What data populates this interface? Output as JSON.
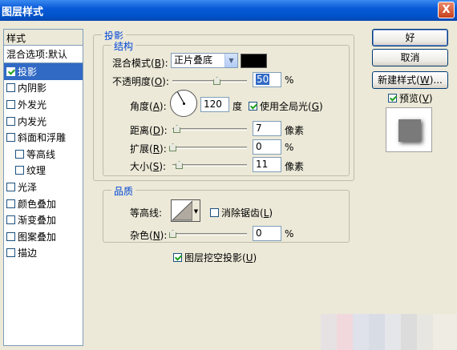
{
  "window": {
    "title": "图层样式",
    "close_glyph": "X"
  },
  "styles_panel": {
    "header": "样式",
    "blend_options": "混合选项:默认",
    "items": [
      {
        "label": "投影",
        "checked": true,
        "selected": true,
        "indent": false
      },
      {
        "label": "内阴影",
        "checked": false,
        "selected": false,
        "indent": false
      },
      {
        "label": "外发光",
        "checked": false,
        "selected": false,
        "indent": false
      },
      {
        "label": "内发光",
        "checked": false,
        "selected": false,
        "indent": false
      },
      {
        "label": "斜面和浮雕",
        "checked": false,
        "selected": false,
        "indent": false
      },
      {
        "label": "等高线",
        "checked": false,
        "selected": false,
        "indent": true
      },
      {
        "label": "纹理",
        "checked": false,
        "selected": false,
        "indent": true
      },
      {
        "label": "光泽",
        "checked": false,
        "selected": false,
        "indent": false
      },
      {
        "label": "颜色叠加",
        "checked": false,
        "selected": false,
        "indent": false
      },
      {
        "label": "渐变叠加",
        "checked": false,
        "selected": false,
        "indent": false
      },
      {
        "label": "图案叠加",
        "checked": false,
        "selected": false,
        "indent": false
      },
      {
        "label": "描边",
        "checked": false,
        "selected": false,
        "indent": false
      }
    ]
  },
  "drop_shadow": {
    "section_title": "投影",
    "structure": {
      "title": "结构",
      "blend_mode_label": "混合模式(",
      "blend_mode_key": "B",
      "blend_mode_value": "正片叠底",
      "shadow_color": "#000000",
      "opacity_label": "不透明度(",
      "opacity_key": "O",
      "opacity_value": "50",
      "opacity_unit": "%",
      "angle_label": "角度(",
      "angle_key": "A",
      "angle_value": "120",
      "angle_unit": "度",
      "global_light_label": "使用全局光(",
      "global_light_key": "G",
      "global_light_checked": true,
      "distance_label": "距离(",
      "distance_key": "D",
      "distance_value": "7",
      "distance_unit": "像素",
      "spread_label": "扩展(",
      "spread_key": "R",
      "spread_value": "0",
      "spread_unit": "%",
      "size_label": "大小(",
      "size_key": "S",
      "size_value": "11",
      "size_unit": "像素"
    },
    "quality": {
      "title": "品质",
      "contour_label": "等高线:",
      "anti_alias_label": "消除锯齿(",
      "anti_alias_key": "L",
      "anti_alias_checked": false,
      "noise_label": "杂色(",
      "noise_key": "N",
      "noise_value": "0",
      "noise_unit": "%"
    },
    "knockout_label": "图层挖空投影(",
    "knockout_key": "U",
    "knockout_checked": true,
    "close_paren": ")",
    "close_paren_colon": "):"
  },
  "buttons": {
    "ok": "好",
    "cancel": "取消",
    "new_style_prefix": "新建样式(",
    "new_style_key": "W",
    "new_style_suffix": ")...",
    "preview_label": "预览(",
    "preview_key": "V",
    "preview_checked": true
  },
  "colors": {
    "title_bar": "#0a5ad8",
    "selection": "#316ac5",
    "group_title": "#0046d5",
    "dialog_bg": "#ece9d8"
  }
}
